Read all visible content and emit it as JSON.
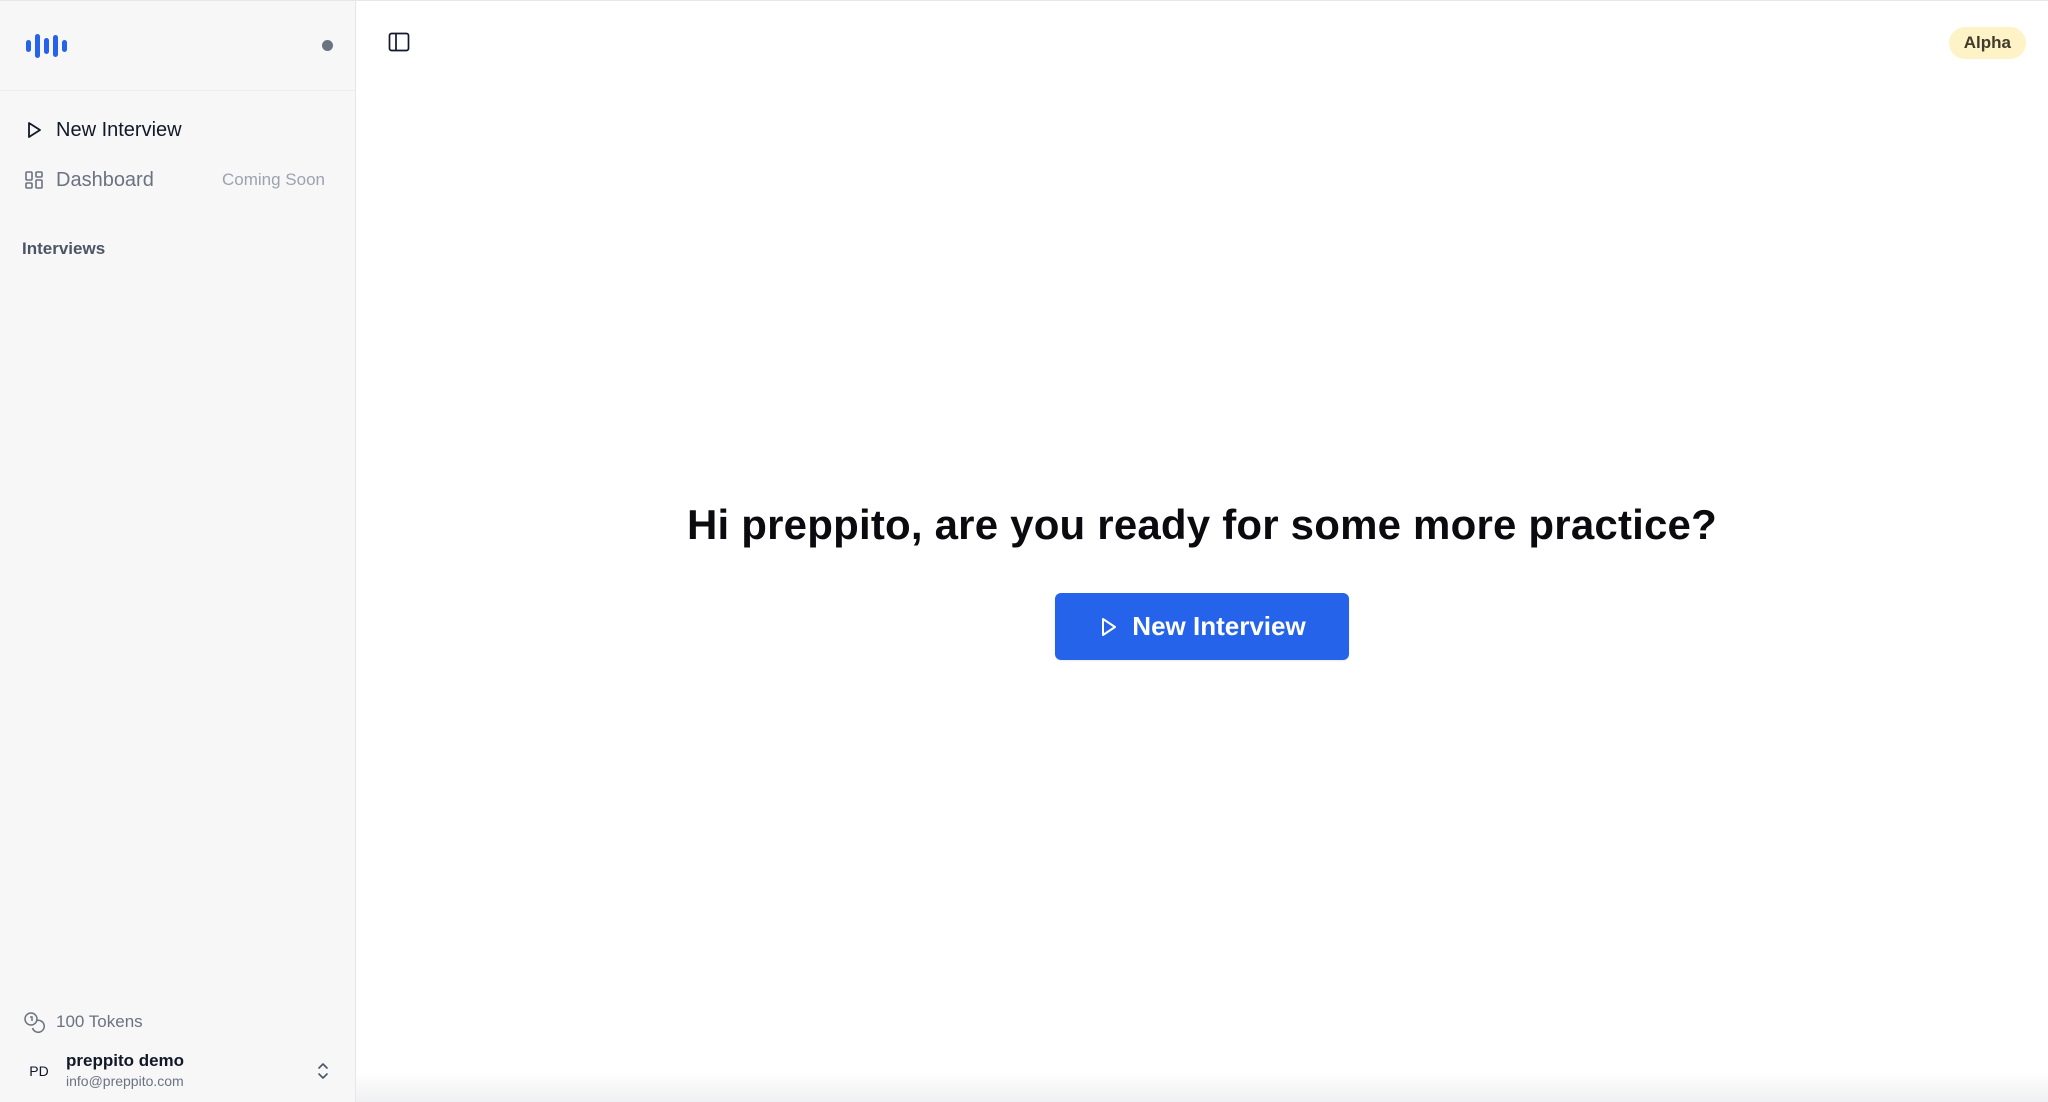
{
  "sidebar": {
    "nav": [
      {
        "label": "New Interview",
        "icon": "play-icon"
      },
      {
        "label": "Dashboard",
        "icon": "grid-icon",
        "tag": "Coming Soon"
      }
    ],
    "section_label": "Interviews",
    "tokens_label": "100 Tokens",
    "user": {
      "initials": "PD",
      "name": "preppito demo",
      "email": "info@preppito.com"
    }
  },
  "header": {
    "badge": "Alpha"
  },
  "main": {
    "greeting": "Hi preppito, are you ready for some more practice?",
    "cta_label": "New Interview"
  },
  "colors": {
    "accent": "#2563eb",
    "badge_bg": "#fdf3c7",
    "sidebar_bg": "#f7f7f8"
  }
}
